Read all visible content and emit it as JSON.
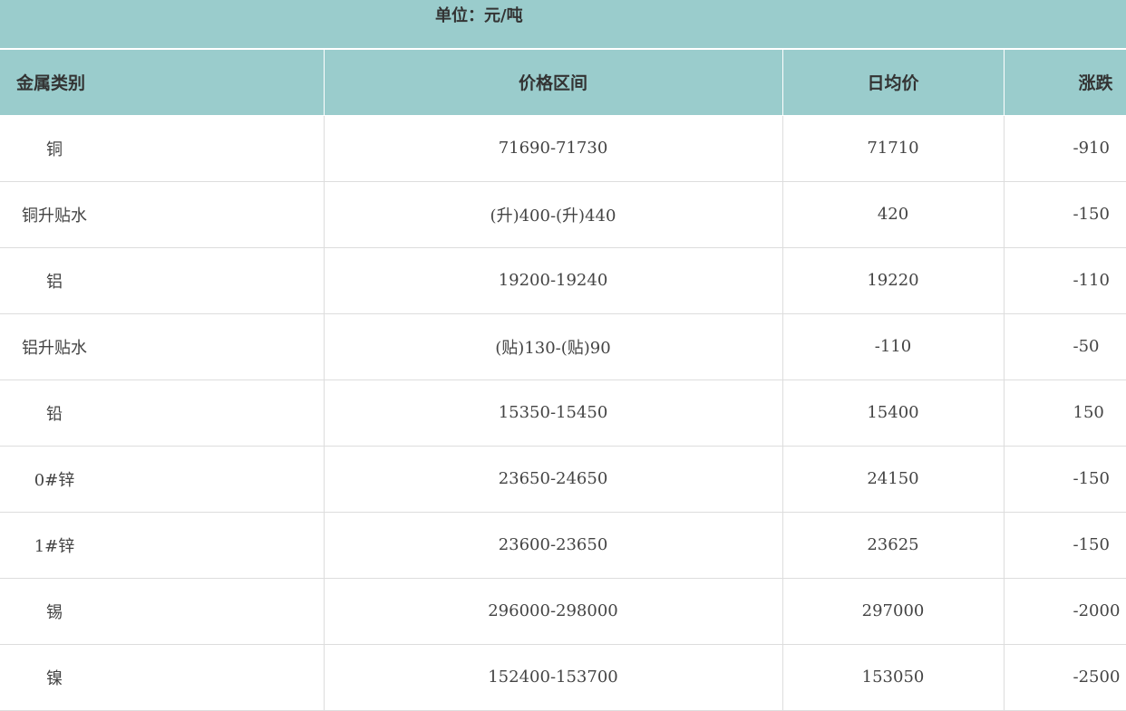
{
  "unit_label": "单位：元/吨",
  "headers": {
    "category": "金属类别",
    "range": "价格区间",
    "average": "日均价",
    "change": "涨跌"
  },
  "rows": [
    {
      "category": "铜",
      "range": "71690-71730",
      "average": "71710",
      "change": "-910"
    },
    {
      "category": "铜升贴水",
      "range": "(升)400-(升)440",
      "average": "420",
      "change": "-150"
    },
    {
      "category": "铝",
      "range": "19200-19240",
      "average": "19220",
      "change": "-110"
    },
    {
      "category": "铝升贴水",
      "range": "(贴)130-(贴)90",
      "average": "-110",
      "change": "-50"
    },
    {
      "category": "铅",
      "range": "15350-15450",
      "average": "15400",
      "change": "150"
    },
    {
      "category": "0#锌",
      "range": "23650-24650",
      "average": "24150",
      "change": "-150"
    },
    {
      "category": "1#锌",
      "range": "23600-23650",
      "average": "23625",
      "change": "-150"
    },
    {
      "category": "锡",
      "range": "296000-298000",
      "average": "297000",
      "change": "-2000"
    },
    {
      "category": "镍",
      "range": "152400-153700",
      "average": "153050",
      "change": "-2500"
    }
  ],
  "colors": {
    "header_bg": "#9acccc",
    "grid_line": "#dddddd"
  }
}
